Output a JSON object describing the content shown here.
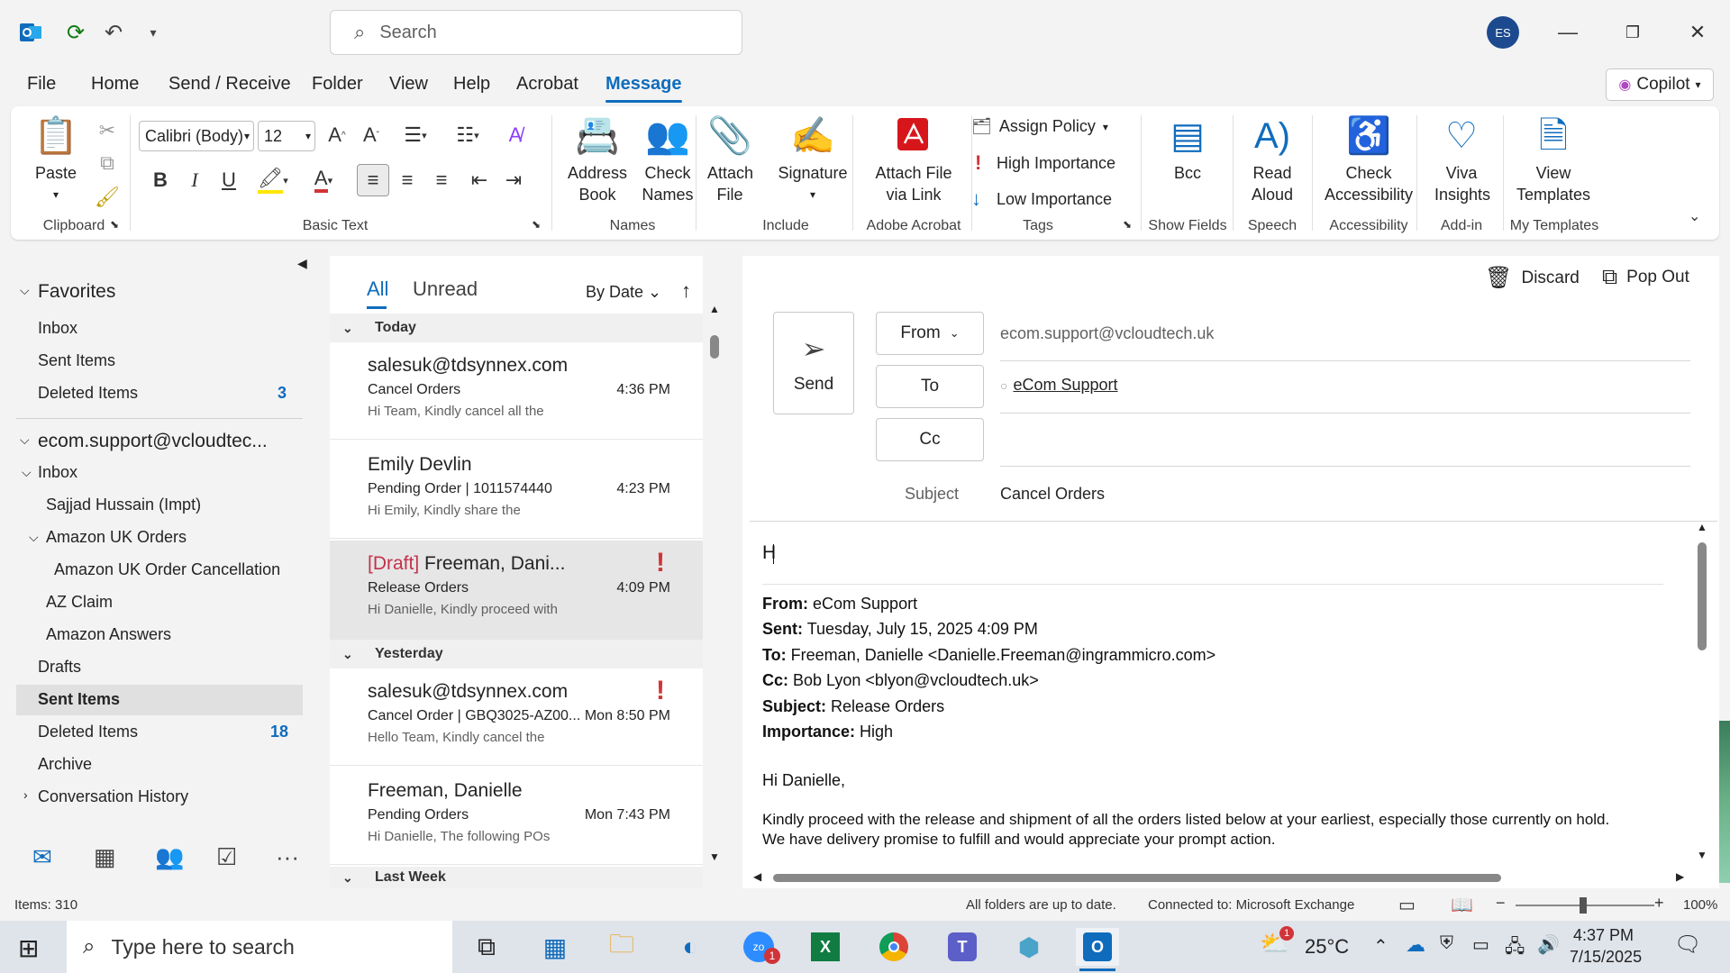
{
  "titlebar": {
    "search_placeholder": "Search",
    "avatar_initials": "ES"
  },
  "menu": {
    "items": [
      "File",
      "Home",
      "Send / Receive",
      "Folder",
      "View",
      "Help",
      "Acrobat",
      "Message"
    ],
    "active": "Message",
    "copilot_label": "Copilot"
  },
  "ribbon": {
    "clipboard": {
      "paste_label": "Paste",
      "group_label": "Clipboard"
    },
    "basic_text": {
      "font_name": "Calibri (Body)",
      "font_size": "12",
      "group_label": "Basic Text"
    },
    "names": {
      "address_book": "Address Book",
      "check_names": "Check Names",
      "group_label": "Names"
    },
    "include": {
      "attach_file": "Attach File",
      "signature": "Signature",
      "group_label": "Include"
    },
    "adobe": {
      "attach_link": "Attach File via Link",
      "group_label": "Adobe Acrobat"
    },
    "tags": {
      "assign_policy": "Assign Policy",
      "high_importance": "High Importance",
      "low_importance": "Low Importance",
      "group_label": "Tags"
    },
    "show_fields": {
      "bcc": "Bcc",
      "group_label": "Show Fields"
    },
    "speech": {
      "read_aloud": "Read Aloud",
      "group_label": "Speech"
    },
    "accessibility": {
      "check": "Check Accessibility",
      "group_label": "Accessibility"
    },
    "addin": {
      "viva": "Viva Insights",
      "group_label": "Add-in"
    },
    "templates": {
      "view": "View Templates",
      "group_label": "My Templates"
    }
  },
  "folders": {
    "favorites_label": "Favorites",
    "favorites": [
      {
        "label": "Inbox"
      },
      {
        "label": "Sent Items"
      },
      {
        "label": "Deleted Items",
        "count": "3"
      }
    ],
    "account_label": "ecom.support@vcloudtec...",
    "inbox_label": "Inbox",
    "inbox_children": [
      "Sajjad Hussain (Impt)"
    ],
    "amazon_label": "Amazon UK Orders",
    "amazon_children": [
      "Amazon UK Order Cancellation"
    ],
    "other": [
      {
        "label": "AZ Claim"
      },
      {
        "label": "Amazon Answers"
      },
      {
        "label": "Drafts"
      },
      {
        "label": "Sent Items"
      },
      {
        "label": "Deleted Items",
        "count": "18"
      },
      {
        "label": "Archive"
      },
      {
        "label": "Conversation History"
      }
    ]
  },
  "message_list": {
    "tab_all": "All",
    "tab_unread": "Unread",
    "sort_label": "By Date",
    "groups": [
      "Today",
      "Yesterday",
      "Last Week"
    ],
    "items": [
      {
        "sender": "salesuk@tdsynnex.com",
        "subject": "Cancel Orders",
        "time": "4:36 PM",
        "preview": "Hi Team,  Kindly cancel all the"
      },
      {
        "sender": "Emily Devlin",
        "subject": "Pending Order |  1011574440",
        "time": "4:23 PM",
        "preview": "Hi Emily,  Kindly share the"
      },
      {
        "draft": "[Draft]",
        "sender": "Freeman, Dani...",
        "subject": "Release Orders",
        "time": "4:09 PM",
        "preview": "Hi Danielle,  Kindly proceed with"
      },
      {
        "sender": "salesuk@tdsynnex.com",
        "subject": "Cancel Order | GBQ3025-AZ00...",
        "time": "Mon 8:50 PM",
        "preview": "Hello Team,  Kindly cancel the"
      },
      {
        "sender": "Freeman, Danielle",
        "subject": "Pending Orders",
        "time": "Mon 7:43 PM",
        "preview": "Hi Danielle,  The following POs"
      }
    ]
  },
  "compose": {
    "discard_label": "Discard",
    "popout_label": "Pop Out",
    "send_label": "Send",
    "from_label": "From",
    "from_value": "ecom.support@vcloudtech.uk",
    "to_label": "To",
    "to_value": "eCom Support",
    "cc_label": "Cc",
    "subject_label": "Subject",
    "subject_value": "Cancel Orders",
    "body_typed": "H",
    "quoted": {
      "from_label": "From:",
      "from": "eCom Support",
      "sent_label": "Sent:",
      "sent": "Tuesday, July 15, 2025 4:09 PM",
      "to_label": "To:",
      "to": "Freeman, Danielle <Danielle.Freeman@ingrammicro.com>",
      "cc_label": "Cc:",
      "cc": "Bob Lyon <blyon@vcloudtech.uk>",
      "subject_label": "Subject:",
      "subject": "Release Orders",
      "importance_label": "Importance:",
      "importance": "High",
      "greeting": "Hi Danielle,",
      "line1": "Kindly proceed with the release and shipment of all the orders listed below at your earliest, especially those currently on hold.",
      "line2": "We have delivery promise to fulfill and would appreciate your prompt action."
    }
  },
  "status": {
    "items": "Items: 310",
    "sync": "All folders are up to date.",
    "connection": "Connected to: Microsoft Exchange",
    "zoom": "100%"
  },
  "taskbar": {
    "search_placeholder": "Type here to search",
    "temperature": "25°C",
    "time": "4:37 PM",
    "date": "7/15/2025",
    "zoom_badge": "1",
    "weather_badge": "1"
  },
  "colors": {
    "accent": "#0f6cbd",
    "flag": "#d13438",
    "draft": "#c4314b"
  }
}
